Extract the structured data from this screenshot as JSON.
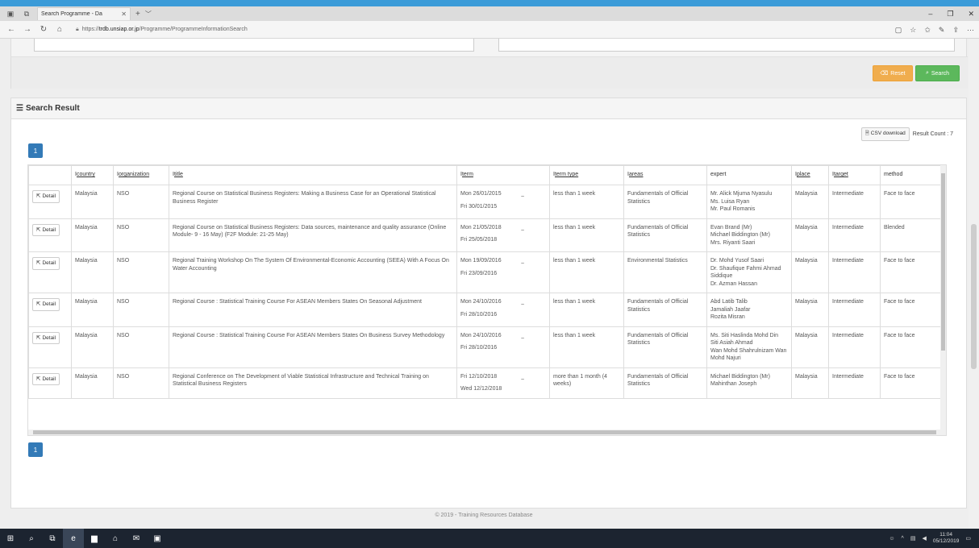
{
  "browser": {
    "tab_title": "Search Programme - Da",
    "url_prefix": "https://",
    "url_host": "trdb.unsiap.or.jp",
    "url_path": "/Programme/ProgrammeInformationSearch"
  },
  "filters": {
    "reset_label": "Reset",
    "search_label": "Search"
  },
  "results": {
    "heading": "Search Result",
    "csv_label": "CSV download",
    "count_text": "Result Count : 7",
    "page_number": "1",
    "detail_label": "Detail",
    "columns": [
      {
        "label": "country",
        "sortable": true
      },
      {
        "label": "organization",
        "sortable": true
      },
      {
        "label": "title",
        "sortable": true
      },
      {
        "label": "term",
        "sortable": true
      },
      {
        "label": "term type",
        "sortable": true
      },
      {
        "label": "areas",
        "sortable": true
      },
      {
        "label": "expert",
        "sortable": false
      },
      {
        "label": "place",
        "sortable": true
      },
      {
        "label": "target",
        "sortable": true
      },
      {
        "label": "method",
        "sortable": false
      }
    ],
    "rows": [
      {
        "country": "Malaysia",
        "organization": "NSO",
        "title": "Regional Course on Statistical Business Registers: Making a Business Case for an Operational Statistical Business Register",
        "term_start": "Mon 26/01/2015",
        "term_end": "Fri 30/01/2015",
        "term_type": "less than 1 week",
        "areas": "Fundamentals of Official Statistics",
        "experts": [
          "Mr. Alick Mjuma Nyasulu",
          "Ms. Luisa Ryan",
          "Mr. Paul Romanis"
        ],
        "place": "Malaysia",
        "target": "Intermediate",
        "method": "Face to face"
      },
      {
        "country": "Malaysia",
        "organization": "NSO",
        "title": "Regional Course on Statistical Business Registers: Data sources, maintenance and quality assurance (Online Module- 9 - 16 May) (F2F Module: 21-25 May)",
        "term_start": "Mon 21/05/2018",
        "term_end": "Fri 25/05/2018",
        "term_type": "less than 1 week",
        "areas": "Fundamentals of Official Statistics",
        "experts": [
          "Evan Brand (Mr)",
          "Michael Biddington (Mr)",
          "Mrs. Riyanti Saari"
        ],
        "place": "Malaysia",
        "target": "Intermediate",
        "method": "Blended"
      },
      {
        "country": "Malaysia",
        "organization": "NSO",
        "title": "Regional Training Workshop On The System Of Environmental-Economic Accounting (SEEA) With A Focus On Water Accounting",
        "term_start": "Mon 19/09/2016",
        "term_end": "Fri 23/09/2016",
        "term_type": "less than 1 week",
        "areas": "Environmental Statistics",
        "experts": [
          "Dr. Mohd Yusof Saari",
          "Dr. Shaufique Fahmi Ahmad Siddique",
          "Dr. Azman Hassan"
        ],
        "place": "Malaysia",
        "target": "Intermediate",
        "method": "Face to face"
      },
      {
        "country": "Malaysia",
        "organization": "NSO",
        "title": "Regional Course : Statistical Training Course For ASEAN Members States On Seasonal Adjustment",
        "term_start": "Mon 24/10/2016",
        "term_end": "Fri 28/10/2016",
        "term_type": "less than 1 week",
        "areas": "Fundamentals of Official Statistics",
        "experts": [
          "Abd Latib Talib",
          "Jamaliah Jaafar",
          "Rozita Misran"
        ],
        "place": "Malaysia",
        "target": "Intermediate",
        "method": "Face to face"
      },
      {
        "country": "Malaysia",
        "organization": "NSO",
        "title": "Regional Course : Statistical Training Course For ASEAN Members States On Business Survey Methodology",
        "term_start": "Mon 24/10/2016",
        "term_end": "Fri 28/10/2016",
        "term_type": "less than 1 week",
        "areas": "Fundamentals of Official Statistics",
        "experts": [
          "Ms. Siti Haslinda Mohd Din",
          "Siti Asiah Ahmad",
          "Wan Mohd Shahrulnizam Wan Mohd Najuri"
        ],
        "place": "Malaysia",
        "target": "Intermediate",
        "method": "Face to face"
      },
      {
        "country": "Malaysia",
        "organization": "NSO",
        "title": "Regional Conference on The Development of Viable Statistical Infrastructure and Technical Training on Statistical Business Registers",
        "term_start": "Fri 12/10/2018",
        "term_end": "Wed 12/12/2018",
        "term_type": "more than 1 month (4 weeks)",
        "areas": "Fundamentals of Official Statistics",
        "experts": [
          "Michael Biddington (Mr)",
          "Mahinthan Joseph"
        ],
        "place": "Malaysia",
        "target": "Intermediate",
        "method": "Face to face"
      }
    ]
  },
  "footer": "© 2019 - Training Resources Database",
  "taskbar": {
    "time": "11:04",
    "date": "05/12/2019"
  }
}
